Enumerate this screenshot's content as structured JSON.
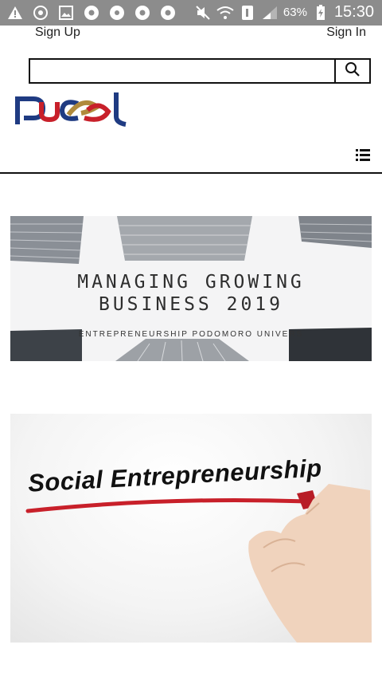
{
  "status_bar": {
    "icons": [
      "warning-icon",
      "sync-icon",
      "image-icon",
      "chrome-icon",
      "settings-icon",
      "chrome-icon",
      "chrome-icon",
      "mute-icon",
      "wifi-icon",
      "sim-icon",
      "signal-icon"
    ],
    "battery": "63%",
    "time": "15:30",
    "bg_color": "#8c8c8c"
  },
  "header": {
    "signup_label": "Sign Up",
    "signin_label": "Sign In",
    "search": {
      "value": "",
      "placeholder": ""
    },
    "logo_text": "pucel"
  },
  "banners": [
    {
      "title_line1": "MANAGING GROWING",
      "title_line2": "BUSINESS 2019",
      "subtitle": "ENTREPRENEURSHIP PODOMORO UNIVERS"
    },
    {
      "text": "Social Entrepreneurship",
      "accent_color": "#c8202a"
    }
  ]
}
